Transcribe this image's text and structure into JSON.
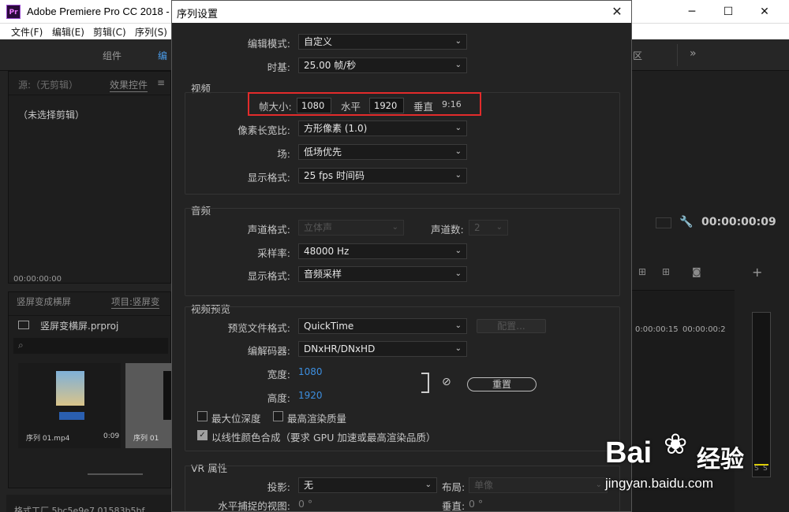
{
  "window": {
    "logo": "Pr",
    "title": "Adobe Premiere Pro CC 2018 -",
    "controls": {
      "minimize": "─",
      "maximize": "☐",
      "close": "✕"
    }
  },
  "menu": [
    "文件(F)",
    "编辑(E)",
    "剪辑(C)",
    "序列(S)"
  ],
  "workspace_tabs": {
    "group": "组件",
    "edit_partial": "编",
    "right_partial": "区",
    "more": "»"
  },
  "source_panel": {
    "tab_source": "源:（无剪辑）",
    "tab_effects": "效果控件",
    "empty_text": "（未选择剪辑）",
    "timecode": "00:00:00:00"
  },
  "project_panel": {
    "tab_left": "竖屏变成横屏",
    "tab_right": "项目:竖屏变",
    "project_name": "竖屏变横屏.prproj",
    "items": [
      {
        "name": "序列 01.mp4",
        "duration": "0:09"
      },
      {
        "name": "序列 01",
        "duration": ""
      }
    ],
    "status_text": "格式工厂    5bc5e9e7   01583b5bf"
  },
  "program_panel": {
    "timecode": "00:00:00:09",
    "ruler": [
      "0:00:00:15",
      "00:00:00:2"
    ],
    "meter_labels": [
      "S",
      "S"
    ]
  },
  "dialog": {
    "title": "序列设置",
    "close": "✕",
    "edit_mode": {
      "label": "编辑模式:",
      "value": "自定义"
    },
    "timebase": {
      "label": "时基:",
      "value": "25.00  帧/秒"
    },
    "video": {
      "section": "视频",
      "frame_size_label": "帧大小:",
      "width_value": "1080",
      "horizontal_label": "水平",
      "height_value": "1920",
      "vertical_label": "垂直",
      "ratio": "9:16",
      "pixel_aspect": {
        "label": "像素长宽比:",
        "value": "方形像素 (1.0)"
      },
      "field": {
        "label": "场:",
        "value": "低场优先"
      },
      "display_format": {
        "label": "显示格式:",
        "value": "25 fps 时间码"
      }
    },
    "audio": {
      "section": "音频",
      "channel_format": {
        "label": "声道格式:",
        "value": "立体声"
      },
      "channels": {
        "label": "声道数:",
        "value": "2"
      },
      "sample_rate": {
        "label": "采样率:",
        "value": "48000 Hz"
      },
      "display_format": {
        "label": "显示格式:",
        "value": "音频采样"
      }
    },
    "preview": {
      "section": "视频预览",
      "file_format": {
        "label": "预览文件格式:",
        "value": "QuickTime"
      },
      "configure_button": "配置...",
      "codec": {
        "label": "编解码器:",
        "value": "DNxHR/DNxHD"
      },
      "width": {
        "label": "宽度:",
        "value": "1080"
      },
      "height": {
        "label": "高度:",
        "value": "1920"
      },
      "reset_button": "重置",
      "max_bit_depth": "最大位深度",
      "max_render_quality": "最高渲染质量",
      "linear_color": "以线性颜色合成（要求 GPU 加速或最高渲染品质）"
    },
    "vr": {
      "section": "VR 属性",
      "projection": {
        "label": "投影:",
        "value": "无"
      },
      "layout": {
        "label": "布局:",
        "value": "单像"
      },
      "h_view": {
        "label": "水平捕捉的视图:",
        "value": "0 °"
      },
      "vertical": {
        "label": "垂直:",
        "value": "0 °"
      }
    }
  },
  "watermark": {
    "brand": "Bai",
    "brand_cn": "经验",
    "url": "jingyan.baidu.com"
  },
  "colors": {
    "highlight": "#e32b2b",
    "link_blue": "#3d8fe0",
    "dialog_bg": "#232323"
  }
}
